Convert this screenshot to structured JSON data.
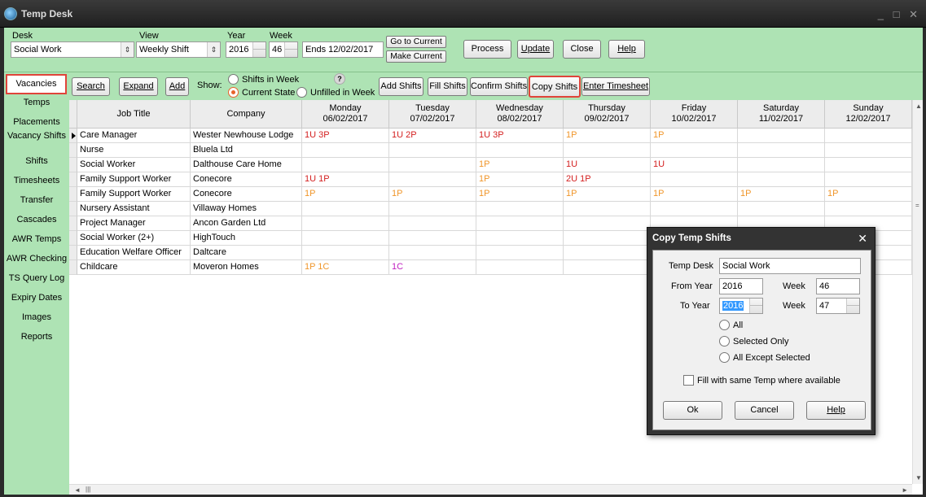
{
  "window": {
    "title": "Temp Desk",
    "controls": "_ □ ✕"
  },
  "topbar": {
    "desk_label": "Desk",
    "desk_value": "Social Work",
    "view_label": "View",
    "view_value": "Weekly Shift",
    "year_label": "Year",
    "year_value": "2016",
    "week_label": "Week",
    "week_value": "46",
    "ends_value": "Ends 12/02/2017",
    "go_to_current": "Go to Current",
    "make_current": "Make Current",
    "process": "Process",
    "update": "Update",
    "close": "Close",
    "help": "Help"
  },
  "sidenav": [
    "Vacancies",
    "Temps",
    "Placements",
    "Vacancy Shifts",
    "Shifts",
    "Timesheets",
    "Transfer",
    "Cascades",
    "AWR Temps",
    "AWR Checking",
    "TS Query Log",
    "Expiry Dates",
    "Images",
    "Reports"
  ],
  "toolbar": {
    "search": "Search",
    "expand": "Expand",
    "add": "Add",
    "show_label": "Show:",
    "opt_shifts_in_week": "Shifts in Week",
    "opt_current_state": "Current State",
    "opt_unfilled": "Unfilled in Week",
    "add_shifts": "Add Shifts",
    "fill_shifts": "Fill Shifts",
    "confirm_shifts": "Confirm Shifts",
    "copy_shifts": "Copy Shifts",
    "enter_timesheet": "Enter Timesheet"
  },
  "grid": {
    "headers": {
      "job_title": "Job Title",
      "company": "Company",
      "days": [
        {
          "day": "Monday",
          "date": "06/02/2017"
        },
        {
          "day": "Tuesday",
          "date": "07/02/2017"
        },
        {
          "day": "Wednesday",
          "date": "08/02/2017"
        },
        {
          "day": "Thursday",
          "date": "09/02/2017"
        },
        {
          "day": "Friday",
          "date": "10/02/2017"
        },
        {
          "day": "Saturday",
          "date": "11/02/2017"
        },
        {
          "day": "Sunday",
          "date": "12/02/2017"
        }
      ]
    },
    "rows": [
      {
        "job": "Care Manager",
        "company": "Wester Newhouse Lodge",
        "cells": [
          "1U 3P",
          "1U 2P",
          "1U 3P",
          "1P",
          "1P",
          "",
          ""
        ]
      },
      {
        "job": "Nurse",
        "company": "Bluela Ltd",
        "cells": [
          "",
          "",
          "",
          "",
          "",
          "",
          ""
        ]
      },
      {
        "job": "Social Worker",
        "company": "Dalthouse Care Home",
        "cells": [
          "",
          "",
          "1P",
          "1U",
          "1U",
          "",
          ""
        ]
      },
      {
        "job": "Family Support Worker",
        "company": "Conecore",
        "cells": [
          "1U 1P",
          "",
          "1P",
          "2U 1P",
          "",
          "",
          ""
        ]
      },
      {
        "job": "Family Support Worker",
        "company": "Conecore",
        "cells": [
          "1P",
          "1P",
          "1P",
          "1P",
          "1P",
          "1P",
          "1P"
        ]
      },
      {
        "job": "Nursery Assistant",
        "company": "Villaway Homes",
        "cells": [
          "",
          "",
          "",
          "",
          "",
          "",
          ""
        ]
      },
      {
        "job": "Project Manager",
        "company": "Ancon Garden Ltd",
        "cells": [
          "",
          "",
          "",
          "",
          "",
          "",
          ""
        ]
      },
      {
        "job": "Social Worker (2+)",
        "company": "HighTouch",
        "cells": [
          "",
          "",
          "",
          "",
          "",
          "",
          ""
        ]
      },
      {
        "job": "Education Welfare Officer",
        "company": "Daltcare",
        "cells": [
          "",
          "",
          "",
          "",
          "",
          "",
          ""
        ]
      },
      {
        "job": "Childcare",
        "company": "Moveron Homes",
        "cells": [
          "1P 1C",
          "1C",
          "",
          "",
          "",
          "",
          ""
        ]
      }
    ]
  },
  "dialog": {
    "title": "Copy Temp Shifts",
    "temp_desk_label": "Temp Desk",
    "temp_desk_value": "Social Work",
    "from_year_label": "From Year",
    "from_year_value": "2016",
    "from_week_label": "Week",
    "from_week_value": "46",
    "to_year_label": "To Year",
    "to_year_value": "2016",
    "to_week_label": "Week",
    "to_week_value": "47",
    "opt_all": "All",
    "opt_selected_only": "Selected Only",
    "opt_all_except": "All Except Selected",
    "fill_same_temp": "Fill with same Temp where available",
    "ok": "Ok",
    "cancel": "Cancel",
    "help": "Help"
  },
  "colors": {
    "red": "#d42020",
    "orange": "#f0962a",
    "magenta": "#c020c0",
    "panel_green": "#aee3b4",
    "highlight_border": "#e0443a"
  }
}
